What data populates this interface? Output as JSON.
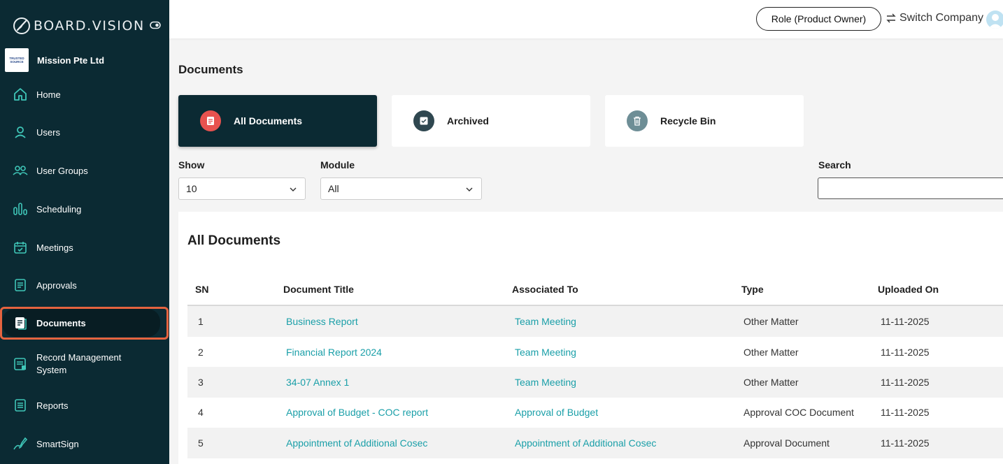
{
  "app": {
    "logo_text": "BOARD.VISION",
    "company_name": "Mission Pte Ltd",
    "company_logo_lines": [
      "TRUSTED",
      "SOURCE"
    ]
  },
  "sidebar": {
    "items": [
      {
        "label": "Home",
        "icon": "home-icon"
      },
      {
        "label": "Users",
        "icon": "user-icon"
      },
      {
        "label": "User Groups",
        "icon": "user-group-icon"
      },
      {
        "label": "Scheduling",
        "icon": "scheduling-icon"
      },
      {
        "label": "Meetings",
        "icon": "calendar-icon"
      },
      {
        "label": "Approvals",
        "icon": "approvals-icon"
      },
      {
        "label": "Documents",
        "icon": "document-icon",
        "active": true
      },
      {
        "label": "Record Management System",
        "icon": "records-icon"
      },
      {
        "label": "Reports",
        "icon": "reports-icon"
      },
      {
        "label": "SmartSign",
        "icon": "signature-icon"
      }
    ]
  },
  "topbar": {
    "role_label": "Role (Product Owner)",
    "switch_label": "Switch Company"
  },
  "main": {
    "title": "Documents",
    "cards": [
      {
        "label": "All Documents",
        "icon": "document-icon",
        "active": true
      },
      {
        "label": "Archived",
        "icon": "archive-icon"
      },
      {
        "label": "Recycle Bin",
        "icon": "trash-icon"
      }
    ],
    "filters": {
      "show_label": "Show",
      "show_value": "10",
      "module_label": "Module",
      "module_value": "All",
      "search_label": "Search",
      "search_value": ""
    },
    "panel_title": "All Documents",
    "table": {
      "columns": [
        "SN",
        "Document Title",
        "Associated To",
        "Type",
        "Uploaded On"
      ],
      "rows": [
        [
          "1",
          "Business Report",
          "Team Meeting",
          "Other Matter",
          "11-11-2025"
        ],
        [
          "2",
          "Financial Report 2024",
          "Team Meeting",
          "Other Matter",
          "11-11-2025"
        ],
        [
          "3",
          "34-07 Annex 1",
          "Team Meeting",
          "Other Matter",
          "11-11-2025"
        ],
        [
          "4",
          "Approval of Budget - COC report",
          "Approval of Budget",
          "Approval COC Document",
          "11-11-2025"
        ],
        [
          "5",
          "Appointment of Additional Cosec",
          "Appointment of Additional Cosec",
          "Approval Document",
          "11-11-2025"
        ]
      ]
    }
  },
  "colors": {
    "sidebar_bg": "#0b2a33",
    "accent_teal": "#1a9fa8",
    "highlight": "#e5633f",
    "doc_icon_red": "#e8524f",
    "archive_icon": "#2f4750",
    "trash_icon": "#6e8e96"
  }
}
